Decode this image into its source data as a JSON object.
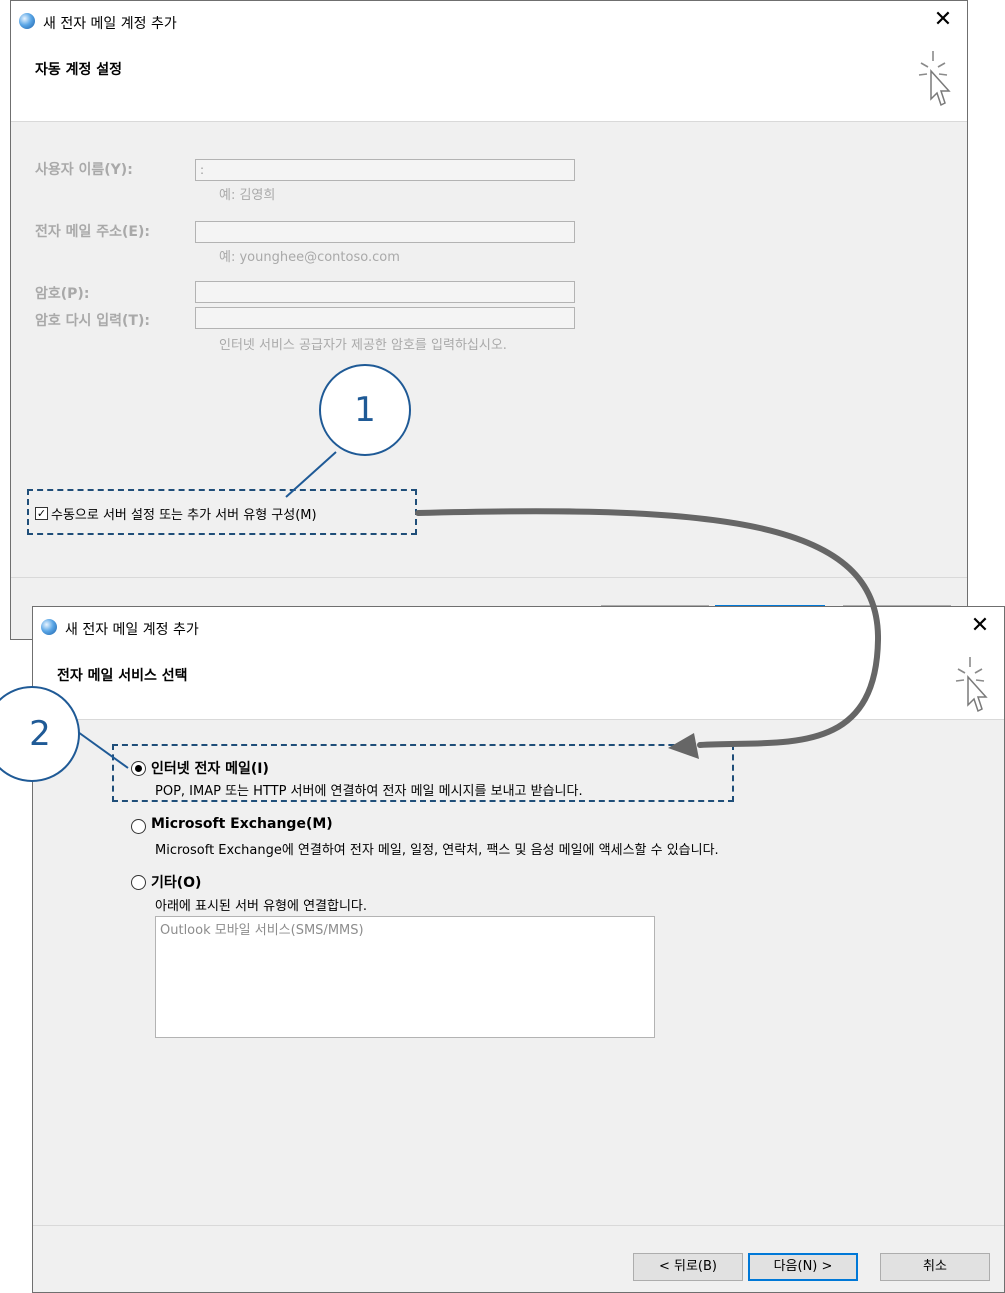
{
  "dialog1": {
    "title": "새 전자 메일 계정 추가",
    "header": "자동 계정 설정",
    "fields": {
      "username_label": "사용자 이름(Y):",
      "username_value": ":",
      "username_hint": "예: 김영희",
      "email_label": "전자 메일 주소(E):",
      "email_hint": "예: younghee@contoso.com",
      "password_label": "암호(P):",
      "password_retype_label": "암호 다시 입력(T):",
      "password_hint": "인터넷 서비스 공급자가 제공한 암호를 입력하십시오."
    },
    "manual_checkbox_label": "수동으로 서버 설정 또는 추가 서버 유형 구성(M)",
    "manual_checked": true
  },
  "dialog2": {
    "title": "새 전자 메일 계정 추가",
    "header": "전자 메일 서비스 선택",
    "options": [
      {
        "title": "인터넷 전자 메일(I)",
        "desc": "POP, IMAP 또는 HTTP 서버에 연결하여 전자 메일 메시지를 보내고 받습니다.",
        "checked": true
      },
      {
        "title": "Microsoft Exchange(M)",
        "desc": "Microsoft Exchange에 연결하여 전자 메일, 일정, 연락처, 팩스 및 음성 메일에 액세스할 수 있습니다.",
        "checked": false
      },
      {
        "title": "기타(O)",
        "desc": "아래에 표시된 서버 유형에 연결합니다.",
        "checked": false
      }
    ],
    "other_list_item": "Outlook 모바일 서비스(SMS/MMS)",
    "buttons": {
      "back": "< 뒤로(B)",
      "next": "다음(N) >",
      "cancel": "취소"
    }
  },
  "callouts": {
    "one": "1",
    "two": "2"
  },
  "colors": {
    "callout": "#1f5a96",
    "arrow": "#666666",
    "primary_button_border": "#0078d7"
  }
}
